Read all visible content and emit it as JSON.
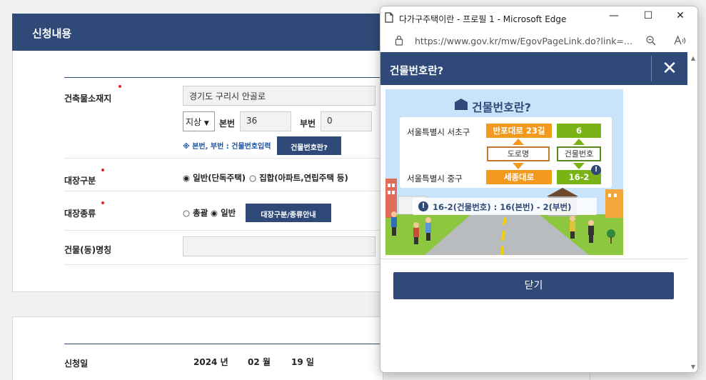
{
  "form": {
    "section_title": "신청내용",
    "address_label": "건축물소재지",
    "address_value": "경기도 구리시 안골로",
    "ground_select": "지상",
    "main_no_label": "본번",
    "main_no_value": "36",
    "sub_no_label": "부번",
    "sub_no_value": "0",
    "note": "※ 본번, 부번 : 건물번호입력",
    "building_no_button": "건물번호란?",
    "register_type_label": "대장구분",
    "register_type_general": "일반(단독주택)",
    "register_type_collective": "집합(아파트,연립주택 등)",
    "register_kind_label": "대장종류",
    "register_kind_total": "총괄",
    "register_kind_general": "일반",
    "register_guide_button": "대장구분/종류안내",
    "building_name_label": "건물(동)명칭",
    "request_date_label": "신청일",
    "year": "2024",
    "year_unit": "년",
    "month": "02",
    "month_unit": "월",
    "day": "19",
    "day_unit": "일"
  },
  "popup": {
    "window_title": "다가구주택이란 - 프로필 1 - Microsoft Edge",
    "url": "https://www.gov.kr/mw/EgovPageLink.do?link=...",
    "minimize": "—",
    "maximize": "☐",
    "close": "✕",
    "header_title": "건물번호란?",
    "header_close": "✕",
    "close_button": "닫기",
    "illustration": {
      "title": "건물번호란?",
      "row1_city": "서울특별시 서초구",
      "row1_road": "반포대로 23길",
      "row1_num": "6",
      "road_tag": "도로명",
      "num_tag": "건물번호",
      "row2_city": "서울특별시 중구",
      "row2_road": "세종대로",
      "row2_num": "16-2",
      "footnote": "16-2(건물번호) : 16(본번) - 2(부번)",
      "alert_mark": "!"
    }
  },
  "colors": {
    "navy": "#2f4a78",
    "orange": "#f39a1e",
    "green": "#7ab315",
    "required": "#e0242b"
  }
}
